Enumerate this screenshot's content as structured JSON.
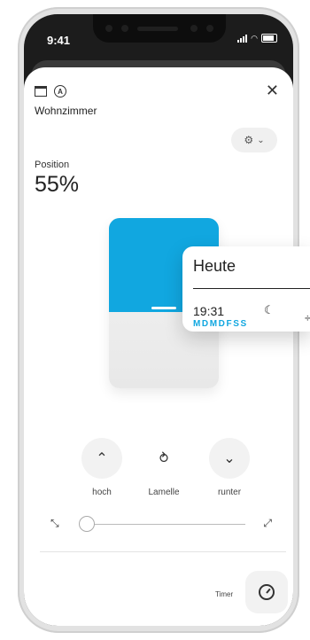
{
  "status_bar": {
    "time": "9:41",
    "signal_icon": "signal-icon",
    "wifi_icon": "wifi-icon",
    "battery_icon": "battery-icon"
  },
  "header": {
    "room_name": "Wohnzimmer",
    "blind_icon": "blind-icon",
    "auto_icon": "auto-mode-icon",
    "auto_glyph": "A",
    "close_icon": "close-icon",
    "close_glyph": "✕",
    "settings_icon": "gear-icon",
    "settings_glyph": "⚙",
    "settings_chevron": "⌄"
  },
  "position": {
    "label": "Position",
    "value_text": "55%",
    "fraction": 0.55
  },
  "controls": {
    "up_label": "hoch",
    "up_glyph": "⌃",
    "slat_label": "Lamelle",
    "slat_glyph": "⥁",
    "down_label": "runter",
    "down_glyph": "⌄"
  },
  "slat_slider": {
    "left_glyph": "⤡",
    "right_glyph": "⤢",
    "value_fraction": 0.0
  },
  "timer": {
    "label": "Timer",
    "icon": "timer-icon"
  },
  "schedule_popup": {
    "title": "Heute",
    "time": "19:31",
    "moon_glyph": "☾",
    "days": "MDMDFSS",
    "edge_glyph": "÷"
  },
  "colors": {
    "accent": "#11a7e0"
  }
}
